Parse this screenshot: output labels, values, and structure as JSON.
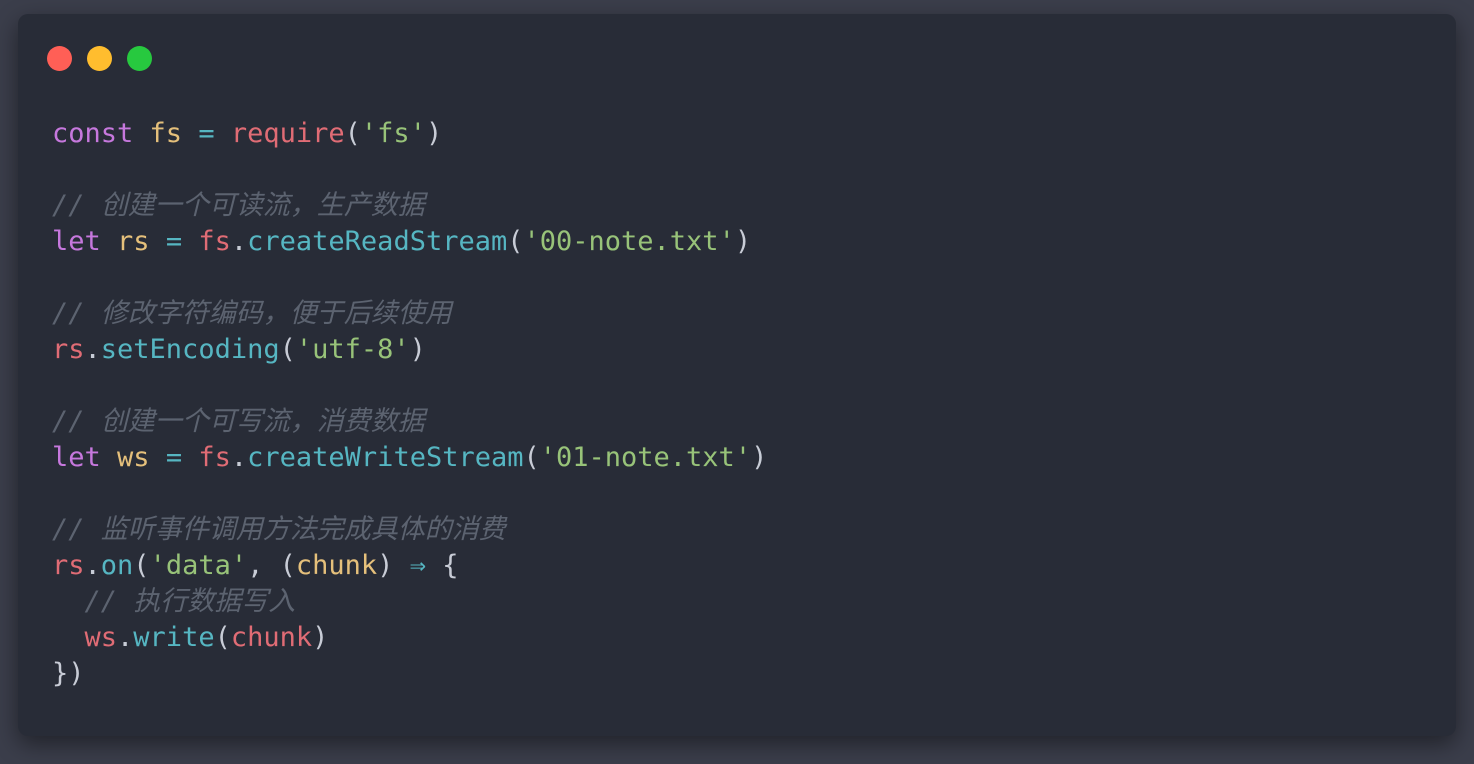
{
  "window": {
    "traffic_lights": [
      "close",
      "minimize",
      "maximize"
    ],
    "colors": {
      "background": "#282c37",
      "close": "#ff5f56",
      "minimize": "#ffbd2e",
      "maximize": "#27c93f"
    }
  },
  "code": {
    "language": "javascript",
    "lines": [
      [
        [
          "kw",
          "const"
        ],
        [
          "punc",
          " "
        ],
        [
          "var-y",
          "fs"
        ],
        [
          "punc",
          " "
        ],
        [
          "op",
          "="
        ],
        [
          "punc",
          " "
        ],
        [
          "var-r",
          "require"
        ],
        [
          "punc",
          "("
        ],
        [
          "str",
          "'fs'"
        ],
        [
          "punc",
          ")"
        ]
      ],
      [],
      [
        [
          "cmt",
          "// 创建一个可读流，生产数据"
        ]
      ],
      [
        [
          "kw",
          "let"
        ],
        [
          "punc",
          " "
        ],
        [
          "var-y",
          "rs"
        ],
        [
          "punc",
          " "
        ],
        [
          "op",
          "="
        ],
        [
          "punc",
          " "
        ],
        [
          "var-r",
          "fs"
        ],
        [
          "punc",
          "."
        ],
        [
          "fn",
          "createReadStream"
        ],
        [
          "punc",
          "("
        ],
        [
          "str",
          "'00-note.txt'"
        ],
        [
          "punc",
          ")"
        ]
      ],
      [],
      [
        [
          "cmt",
          "// 修改字符编码，便于后续使用"
        ]
      ],
      [
        [
          "var-r",
          "rs"
        ],
        [
          "punc",
          "."
        ],
        [
          "fn",
          "setEncoding"
        ],
        [
          "punc",
          "("
        ],
        [
          "str",
          "'utf-8'"
        ],
        [
          "punc",
          ")"
        ]
      ],
      [],
      [
        [
          "cmt",
          "// 创建一个可写流，消费数据"
        ]
      ],
      [
        [
          "kw",
          "let"
        ],
        [
          "punc",
          " "
        ],
        [
          "var-y",
          "ws"
        ],
        [
          "punc",
          " "
        ],
        [
          "op",
          "="
        ],
        [
          "punc",
          " "
        ],
        [
          "var-r",
          "fs"
        ],
        [
          "punc",
          "."
        ],
        [
          "fn",
          "createWriteStream"
        ],
        [
          "punc",
          "("
        ],
        [
          "str",
          "'01-note.txt'"
        ],
        [
          "punc",
          ")"
        ]
      ],
      [],
      [
        [
          "cmt",
          "// 监听事件调用方法完成具体的消费"
        ]
      ],
      [
        [
          "var-r",
          "rs"
        ],
        [
          "punc",
          "."
        ],
        [
          "fn",
          "on"
        ],
        [
          "punc",
          "("
        ],
        [
          "str",
          "'data'"
        ],
        [
          "punc",
          ", ("
        ],
        [
          "var-y",
          "chunk"
        ],
        [
          "punc",
          ") "
        ],
        [
          "op",
          "⇒"
        ],
        [
          "punc",
          " {"
        ]
      ],
      [
        [
          "punc",
          "  "
        ],
        [
          "cmt",
          "// 执行数据写入"
        ]
      ],
      [
        [
          "punc",
          "  "
        ],
        [
          "var-r",
          "ws"
        ],
        [
          "punc",
          "."
        ],
        [
          "fn",
          "write"
        ],
        [
          "punc",
          "("
        ],
        [
          "var-r",
          "chunk"
        ],
        [
          "punc",
          ")"
        ]
      ],
      [
        [
          "punc",
          "})"
        ]
      ]
    ]
  }
}
